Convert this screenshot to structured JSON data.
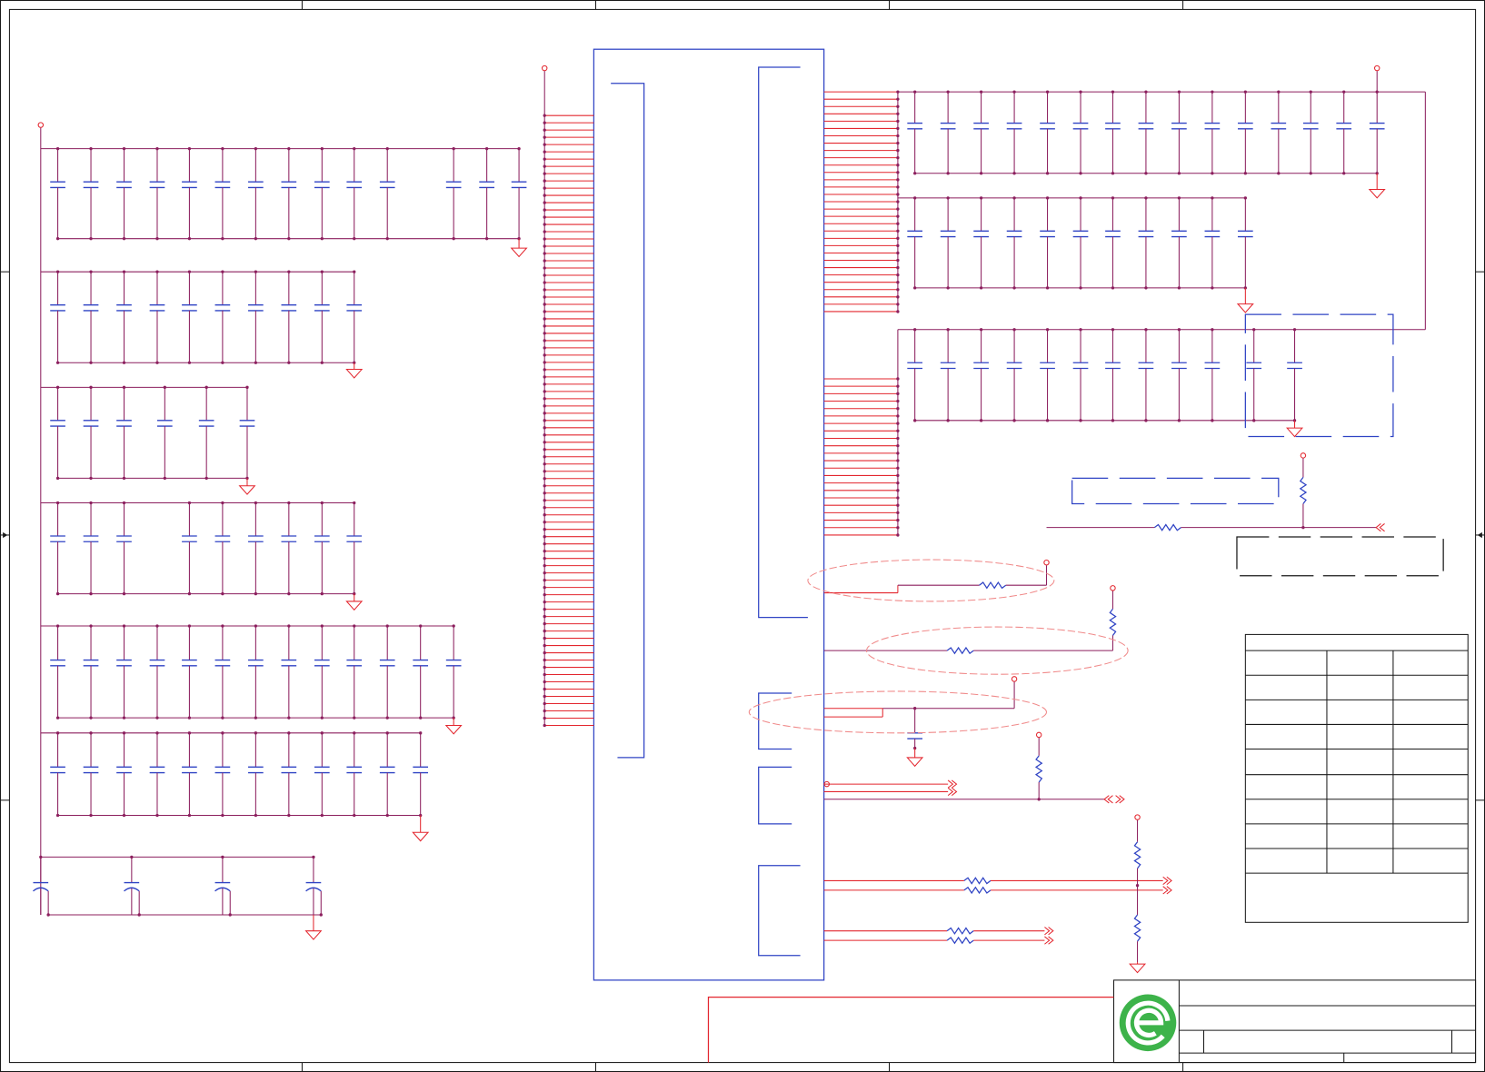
{
  "colors": {
    "background": "#ffffff",
    "frame": "#1a1a1a",
    "wire": "#e3262e",
    "net": "#8c1f5e",
    "component": "#2f43c4",
    "highlight": "#f08a8a",
    "logo_green": "#3db34a"
  },
  "icons": {
    "logo": "logo-icon"
  }
}
